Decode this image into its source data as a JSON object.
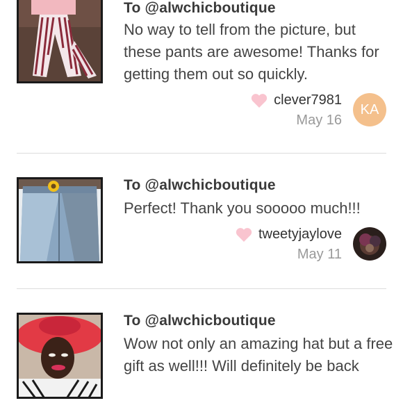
{
  "reviews": [
    {
      "to": "To @alwchicboutique",
      "message": "No way to tell from the picture, but these pants are awesome! Thanks for getting them out so quickly.",
      "username": "clever7981",
      "date": "May 16",
      "avatar_initials": "KA",
      "thumbnail": "striped-pants-photo"
    },
    {
      "to": "To @alwchicboutique",
      "message": "Perfect! Thank you sooooo much!!!",
      "username": "tweetyjaylove",
      "date": "May 11",
      "thumbnail": "denim-skirt-photo"
    },
    {
      "to": "To @alwchicboutique",
      "message": "Wow not only an amazing hat but a free gift as well!!! Will definitely be back",
      "thumbnail": "red-hat-selfie-photo"
    }
  ],
  "colors": {
    "heart": "#f9c4cf",
    "avatar_bg": "#f4c08c",
    "divider": "#dcdcdc",
    "thumb_border": "#1a1a1a"
  },
  "icons": {
    "like": "heart-icon"
  }
}
